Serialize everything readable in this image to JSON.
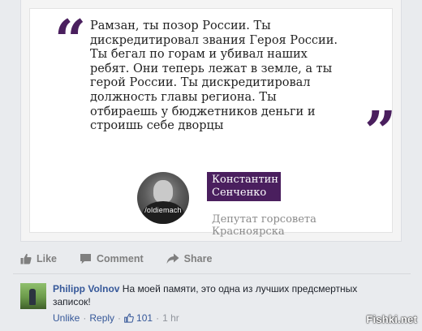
{
  "post_image": {
    "quote_open": "“",
    "quote_close": "”",
    "quote_lines": [
      "Рамзан, ты позор России. Ты",
      "дискредитировал звания Героя России.",
      "Ты бегал по горам и убивал наших",
      "ребят. Они теперь лежат в земле, а ты",
      "герой России. Ты дискредитировал",
      "должность главы региона. Ты",
      "отбираешь у бюджетников деньги и",
      "строишь себе дворцы"
    ],
    "avatar_handle": "/oldiemach",
    "name_line1": "Константин",
    "name_line2": "Сенченко",
    "position": "Депутат горсовета Красноярска",
    "accent_color": "#4a1f5e"
  },
  "actions": {
    "like": "Like",
    "comment": "Comment",
    "share": "Share"
  },
  "comment": {
    "author": "Philipp Volnov",
    "text": "На моей памяти, это одна из лучших предсмертных записок!",
    "unlike": "Unlike",
    "reply": "Reply",
    "likes": "101",
    "time": "1 hr",
    "separator": "·"
  },
  "watermark": "Fishki.net",
  "icons": {
    "like": "thumbs-up-icon",
    "comment": "comment-bubble-icon",
    "share": "share-arrow-icon",
    "comment_like": "thumbs-up-icon"
  }
}
